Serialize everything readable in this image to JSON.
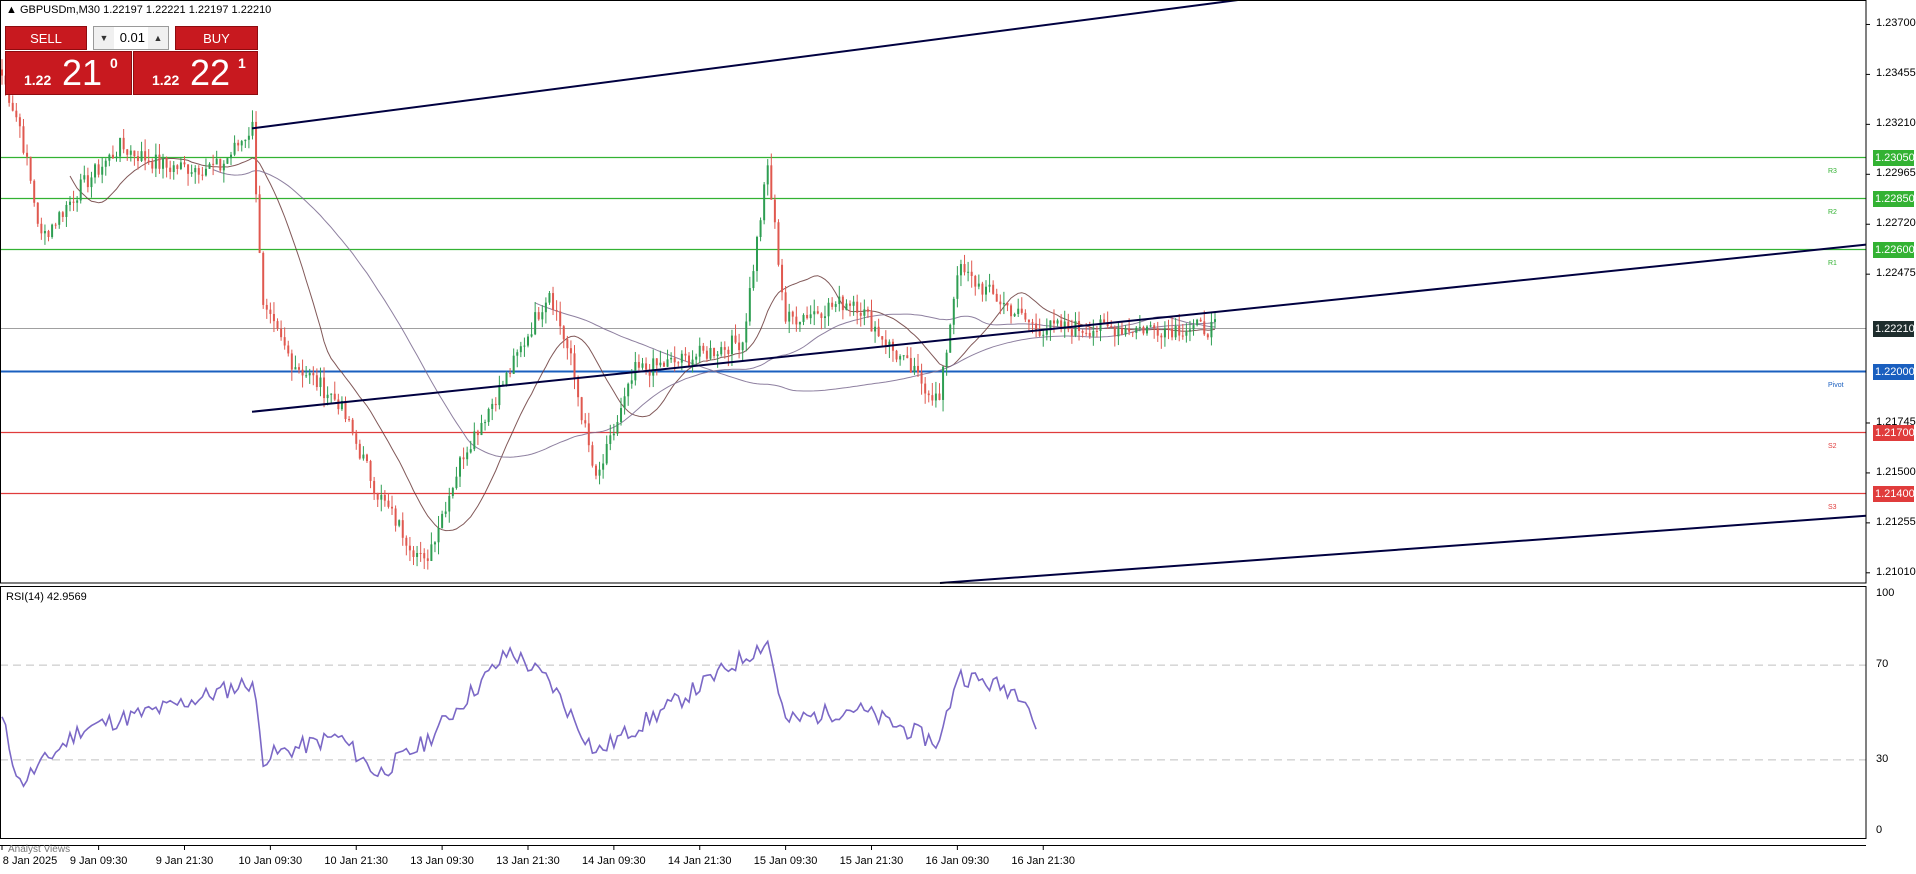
{
  "header": {
    "symbol_line": "GBPUSDm,M30  1.22197 1.22221 1.22197 1.22210"
  },
  "trade_panel": {
    "sell_label": "SELL",
    "buy_label": "BUY",
    "lot_value": "0.01",
    "sell_price_small": "1.22",
    "sell_price_big": "21",
    "sell_price_sup": "0",
    "buy_price_small": "1.22",
    "buy_price_big": "22",
    "buy_price_sup": "1"
  },
  "rsi": {
    "label": "RSI(14) 42.9569",
    "axis_labels": [
      "100",
      "70",
      "30",
      "0"
    ],
    "levels": [
      70,
      30
    ]
  },
  "levels": [
    {
      "price": 1.2305,
      "label": "1.23050",
      "tag": "R3",
      "color": "#33b233"
    },
    {
      "price": 1.2285,
      "label": "1.22850",
      "tag": "R2",
      "color": "#33b233"
    },
    {
      "price": 1.226,
      "label": "1.22600",
      "tag": "R1",
      "color": "#33b233"
    },
    {
      "price": 1.22,
      "label": "1.22000",
      "tag": "Pivot",
      "color": "#1a5fbf"
    },
    {
      "price": 1.217,
      "label": "1.21700",
      "tag": "S2",
      "color": "#e03c3c"
    },
    {
      "price": 1.214,
      "label": "1.21400",
      "tag": "S3",
      "color": "#e03c3c"
    }
  ],
  "current_price": {
    "price": 1.2221,
    "label": "1.22210",
    "color": "#1e2d2d"
  },
  "price_axis_labels": [
    "1.23700",
    "1.23455",
    "1.23210",
    "1.22965",
    "1.22720",
    "1.22475",
    "1.21745",
    "1.21500",
    "1.21255",
    "1.21010"
  ],
  "time_axis_labels": [
    "8 Jan 2025",
    "9 Jan 09:30",
    "9 Jan 21:30",
    "10 Jan 09:30",
    "10 Jan 21:30",
    "13 Jan 09:30",
    "13 Jan 21:30",
    "14 Jan 09:30",
    "14 Jan 21:30",
    "15 Jan 09:30",
    "15 Jan 21:30",
    "16 Jan 09:30",
    "16 Jan 21:30"
  ],
  "bottom_panel_label": "Analyst Views",
  "colors": {
    "bull_candle": "#2e9e52",
    "bear_candle": "#e0584f",
    "rsi_line": "#7b68c6",
    "trendline": "#000040",
    "ma_fast": "#6b3b3b",
    "ma_slow": "#7a6a8f"
  },
  "chart_data": {
    "type": "candlestick",
    "symbol": "GBPUSDm",
    "timeframe": "M30",
    "ylim": [
      1.2096,
      1.2382
    ],
    "x_range": [
      "8 Jan 2025",
      "16 Jan 23:00"
    ],
    "approx_close_path": [
      {
        "time": "8 Jan 2025",
        "close": 1.2345
      },
      {
        "time": "9 Jan 01:00",
        "close": 1.232
      },
      {
        "time": "9 Jan 04:00",
        "close": 1.2265
      },
      {
        "time": "9 Jan 09:30",
        "close": 1.229
      },
      {
        "time": "9 Jan 15:00",
        "close": 1.231
      },
      {
        "time": "9 Jan 21:30",
        "close": 1.23
      },
      {
        "time": "10 Jan 05:00",
        "close": 1.23
      },
      {
        "time": "10 Jan 09:30",
        "close": 1.232
      },
      {
        "time": "10 Jan 11:00",
        "close": 1.223
      },
      {
        "time": "10 Jan 15:00",
        "close": 1.2205
      },
      {
        "time": "10 Jan 21:30",
        "close": 1.2185
      },
      {
        "time": "13 Jan 03:00",
        "close": 1.214
      },
      {
        "time": "13 Jan 09:30",
        "close": 1.2105
      },
      {
        "time": "13 Jan 15:00",
        "close": 1.216
      },
      {
        "time": "13 Jan 21:30",
        "close": 1.22
      },
      {
        "time": "14 Jan 03:00",
        "close": 1.224
      },
      {
        "time": "14 Jan 06:00",
        "close": 1.2205
      },
      {
        "time": "14 Jan 09:30",
        "close": 1.2145
      },
      {
        "time": "14 Jan 15:00",
        "close": 1.22
      },
      {
        "time": "14 Jan 21:30",
        "close": 1.2205
      },
      {
        "time": "15 Jan 06:00",
        "close": 1.2215
      },
      {
        "time": "15 Jan 09:30",
        "close": 1.23
      },
      {
        "time": "15 Jan 12:00",
        "close": 1.2225
      },
      {
        "time": "15 Jan 21:30",
        "close": 1.2235
      },
      {
        "time": "16 Jan 03:00",
        "close": 1.221
      },
      {
        "time": "16 Jan 09:30",
        "close": 1.2185
      },
      {
        "time": "16 Jan 12:00",
        "close": 1.225
      },
      {
        "time": "16 Jan 21:30",
        "close": 1.2225
      },
      {
        "time": "16 Jan 23:00",
        "close": 1.2221
      }
    ],
    "rsi_series": [
      {
        "time": "8 Jan 2025",
        "value": 47
      },
      {
        "time": "9 Jan 01:00",
        "value": 20
      },
      {
        "time": "9 Jan 09:30",
        "value": 43
      },
      {
        "time": "9 Jan 21:30",
        "value": 52
      },
      {
        "time": "10 Jan 09:30",
        "value": 63
      },
      {
        "time": "10 Jan 11:00",
        "value": 31
      },
      {
        "time": "10 Jan 21:30",
        "value": 40
      },
      {
        "time": "13 Jan 03:00",
        "value": 24
      },
      {
        "time": "13 Jan 09:30",
        "value": 37
      },
      {
        "time": "13 Jan 21:30",
        "value": 76
      },
      {
        "time": "14 Jan 03:00",
        "value": 63
      },
      {
        "time": "14 Jan 09:30",
        "value": 33
      },
      {
        "time": "14 Jan 21:30",
        "value": 56
      },
      {
        "time": "15 Jan 09:30",
        "value": 80
      },
      {
        "time": "15 Jan 12:00",
        "value": 46
      },
      {
        "time": "15 Jan 21:30",
        "value": 52
      },
      {
        "time": "16 Jan 09:30",
        "value": 37
      },
      {
        "time": "16 Jan 12:00",
        "value": 66
      },
      {
        "time": "16 Jan 21:30",
        "value": 58
      },
      {
        "time": "16 Jan 23:00",
        "value": 42.9569
      }
    ]
  }
}
